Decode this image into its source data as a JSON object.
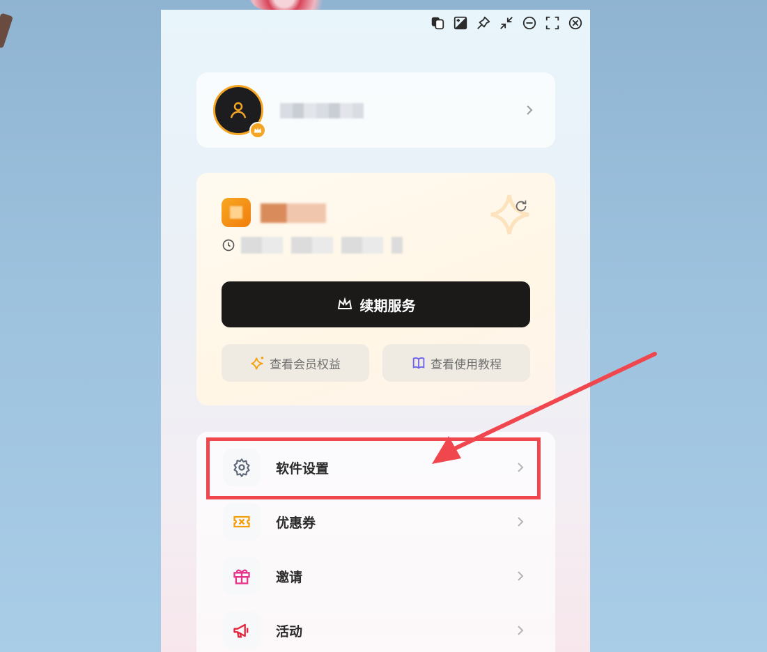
{
  "window_controls": [
    {
      "icon": "copy-icon"
    },
    {
      "icon": "image-adjust-icon"
    },
    {
      "icon": "pin-icon"
    },
    {
      "icon": "minimize-collapse-icon"
    },
    {
      "icon": "minus-circle-icon"
    },
    {
      "icon": "fullscreen-icon"
    },
    {
      "icon": "close-circle-icon"
    }
  ],
  "profile": {
    "username": "",
    "avatar_icon": "user-icon",
    "badge_icon": "crown-icon"
  },
  "membership": {
    "name": "",
    "expire_text": "",
    "renew_label": "续期服务",
    "benefits_label": "查看会员权益",
    "tutorial_label": "查看使用教程",
    "accent": "#f5a524"
  },
  "menu": [
    {
      "label": "软件设置",
      "icon": "gear-icon"
    },
    {
      "label": "优惠券",
      "icon": "ticket-icon"
    },
    {
      "label": "邀请",
      "icon": "gift-icon"
    },
    {
      "label": "活动",
      "icon": "megaphone-icon"
    }
  ],
  "annotation": {
    "color": "#f0474f"
  }
}
